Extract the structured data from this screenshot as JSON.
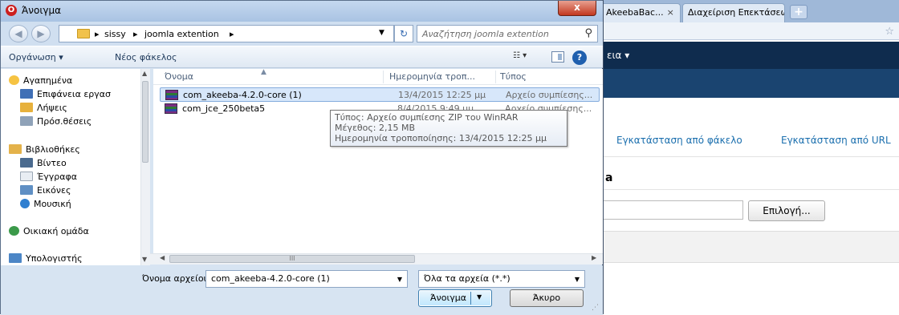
{
  "browser": {
    "tabs": [
      {
        "label": "AkeebaBac...",
        "close": "×"
      },
      {
        "label": "Διαχείριση Επεκτάσεω...",
        "close": "×"
      }
    ],
    "new_tab": "+",
    "toolbar_menu": "εια ▾",
    "install_from_folder": "Εγκατάσταση από φάκελο",
    "install_from_url": "Εγκατάσταση από URL",
    "section_fragment": "a",
    "browse_button": "Επιλογή..."
  },
  "dialog": {
    "title": "Άνοιγμα",
    "close": "x",
    "breadcrumbs": [
      "sissy",
      "joomla extention"
    ],
    "search_placeholder": "Αναζήτηση joomla extention",
    "organize": "Οργάνωση ▾",
    "new_folder": "Νέος φάκελος",
    "nav_items": [
      {
        "label": "Αγαπημένα",
        "icon": "star-icon"
      },
      {
        "label": "Επιφάνεια εργασ",
        "icon": "desktop-icon"
      },
      {
        "label": "Λήψεις",
        "icon": "downloads-icon"
      },
      {
        "label": "Πρόσ.θέσεις",
        "icon": "recent-places-icon"
      },
      {
        "label": "Βιβλιοθήκες",
        "icon": "libraries-icon"
      },
      {
        "label": "Βίντεο",
        "icon": "video-icon"
      },
      {
        "label": "Έγγραφα",
        "icon": "documents-icon"
      },
      {
        "label": "Εικόνες",
        "icon": "pictures-icon"
      },
      {
        "label": "Μουσική",
        "icon": "music-icon"
      },
      {
        "label": "Οικιακή ομάδα",
        "icon": "homegroup-icon"
      },
      {
        "label": "Υπολογιστής",
        "icon": "computer-icon"
      }
    ],
    "columns": {
      "name": "Όνομα",
      "date": "Ημερομηνία τροπ...",
      "type": "Τύπος"
    },
    "files": [
      {
        "name": "com_akeeba-4.2.0-core (1)",
        "date": "13/4/2015 12:25 μμ",
        "type": "Αρχείο συμπίεσης..."
      },
      {
        "name": "com_jce_250beta5",
        "date": "8/4/2015 9:49 μμ",
        "type": "Αρχείο συμπίεσης..."
      }
    ],
    "tooltip": [
      "Τύπος: Αρχείο συμπίεσης ZIP του WinRAR",
      "Μέγεθος: 2,15 MB",
      "Ημερομηνία τροποποίησης: 13/4/2015 12:25 μμ"
    ],
    "filename_label": "Όνομα αρχείου:",
    "filename_value": "com_akeeba-4.2.0-core (1)",
    "filetype_value": "Όλα τα αρχεία (*.*)",
    "open_button": "Άνοιγμα",
    "cancel_button": "Άκυρο"
  }
}
